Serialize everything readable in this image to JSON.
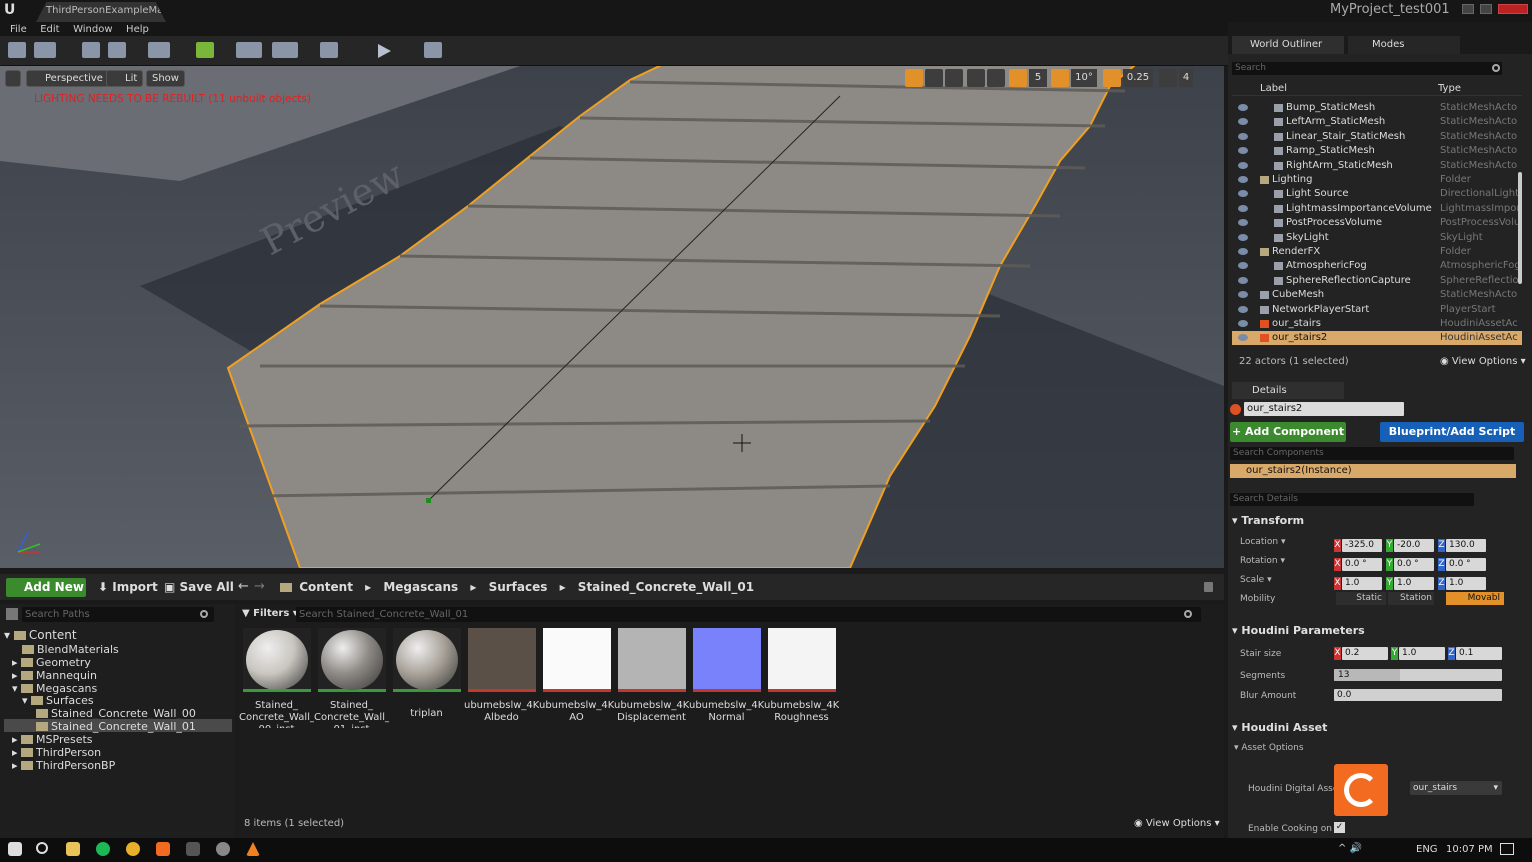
{
  "window": {
    "doc_tab": "ThirdPersonExampleMap*",
    "project": "MyProject_test001"
  },
  "menu": [
    "File",
    "Edit",
    "Window",
    "Help"
  ],
  "viewport": {
    "perspective": "Perspective",
    "lit": "Lit",
    "show": "Show",
    "warning": "LIGHTING NEEDS TO BE REBUILT (11 unbuilt objects)",
    "preview_watermark": "Preview",
    "grid_snap": "5",
    "rot_snap": "10°",
    "scale_snap": "0.25",
    "cam_speed": "4"
  },
  "outliner": {
    "tab_world": "World Outliner",
    "tab_modes": "Modes",
    "search_placeholder": "Search",
    "col_label": "Label",
    "col_type": "Type",
    "rows": [
      {
        "label": "Bump_StaticMesh",
        "type": "StaticMeshActor",
        "indent": 2
      },
      {
        "label": "LeftArm_StaticMesh",
        "type": "StaticMeshActor",
        "indent": 2
      },
      {
        "label": "Linear_Stair_StaticMesh",
        "type": "StaticMeshActor",
        "indent": 2
      },
      {
        "label": "Ramp_StaticMesh",
        "type": "StaticMeshActor",
        "indent": 2
      },
      {
        "label": "RightArm_StaticMesh",
        "type": "StaticMeshActor",
        "indent": 2
      },
      {
        "label": "Lighting",
        "type": "Folder",
        "indent": 1
      },
      {
        "label": "Light Source",
        "type": "DirectionalLight",
        "indent": 2
      },
      {
        "label": "LightmassImportanceVolume",
        "type": "LightmassImporta",
        "indent": 2
      },
      {
        "label": "PostProcessVolume",
        "type": "PostProcessVolu",
        "indent": 2
      },
      {
        "label": "SkyLight",
        "type": "SkyLight",
        "indent": 2
      },
      {
        "label": "RenderFX",
        "type": "Folder",
        "indent": 1
      },
      {
        "label": "AtmosphericFog",
        "type": "AtmosphericFog",
        "indent": 2
      },
      {
        "label": "SphereReflectionCapture",
        "type": "SphereReflection",
        "indent": 2
      },
      {
        "label": "CubeMesh",
        "type": "StaticMeshActor",
        "indent": 1
      },
      {
        "label": "NetworkPlayerStart",
        "type": "PlayerStart",
        "indent": 1
      },
      {
        "label": "our_stairs",
        "type": "HoudiniAssetActo",
        "indent": 1
      },
      {
        "label": "our_stairs2",
        "type": "HoudiniAssetActo",
        "indent": 1
      }
    ],
    "status": "22 actors (1 selected)",
    "view_options": "View Options"
  },
  "details": {
    "tab": "Details",
    "name": "our_stairs2",
    "add_component": "Add Component",
    "blueprint": "Blueprint/Add Script",
    "search_components": "Search Components",
    "instance": "our_stairs2(Instance)",
    "search_details": "Search Details",
    "transform": "Transform",
    "location_label": "Location",
    "rotation_label": "Rotation",
    "scale_label": "Scale",
    "mobility_label": "Mobility",
    "location": [
      "-325.0",
      "-20.0",
      "130.0"
    ],
    "rotation": [
      "0.0 °",
      "0.0 °",
      "0.0 °"
    ],
    "scale": [
      "1.0",
      "1.0",
      "1.0"
    ],
    "mobility": [
      "Static",
      "Station",
      "Movabl"
    ],
    "houdini_params": "Houdini Parameters",
    "stair_size_label": "Stair size",
    "stair_size": [
      "0.2",
      "1.0",
      "0.1"
    ],
    "segments_label": "Segments",
    "segments": "13",
    "segments_fill": 0.13,
    "blur_label": "Blur Amount",
    "blur": "0.0",
    "houdini_asset": "Houdini Asset",
    "asset_options": "Asset Options",
    "digital_asset_label": "Houdini Digital Asset",
    "digital_asset": "our_stairs",
    "cooking_label": "Enable Cooking on Pa"
  },
  "content": {
    "add_new": "Add New",
    "import": "Import",
    "save_all": "Save All",
    "breadcrumb": [
      "Content",
      "Megascans",
      "Surfaces",
      "Stained_Concrete_Wall_01"
    ],
    "search_paths": "Search Paths",
    "filters": "Filters",
    "search_assets": "Search Stained_Concrete_Wall_01",
    "tree": [
      {
        "label": "Content",
        "indent": 0
      },
      {
        "label": "BlendMaterials",
        "indent": 1
      },
      {
        "label": "Geometry",
        "indent": 1
      },
      {
        "label": "Mannequin",
        "indent": 1
      },
      {
        "label": "Megascans",
        "indent": 1
      },
      {
        "label": "Surfaces",
        "indent": 2
      },
      {
        "label": "Stained_Concrete_Wall_00",
        "indent": 3
      },
      {
        "label": "Stained_Concrete_Wall_01",
        "indent": 3
      },
      {
        "label": "MSPresets",
        "indent": 1
      },
      {
        "label": "ThirdPerson",
        "indent": 1
      },
      {
        "label": "ThirdPersonBP",
        "indent": 1
      }
    ],
    "assets": [
      {
        "l1": "Stained_",
        "l2": "Concrete_Wall_",
        "l3": "00_inst",
        "color": "#c9c6c0"
      },
      {
        "l1": "Stained_",
        "l2": "Concrete_Wall_",
        "l3": "01_inst",
        "color": "#8e8b86"
      },
      {
        "l1": "triplan",
        "l2": "",
        "l3": "",
        "color": "#a9a39a"
      },
      {
        "l1": "ubumebslw_4K_",
        "l2": "Albedo",
        "l3": "",
        "color": "#5b5048"
      },
      {
        "l1": "ubumebslw_4K_",
        "l2": "AO",
        "l3": "",
        "color": "#fafafa"
      },
      {
        "l1": "ubumebslw_4K_",
        "l2": "Displacement",
        "l3": "",
        "color": "#b4b4b4"
      },
      {
        "l1": "ubumebslw_4K_",
        "l2": "Normal",
        "l3": "",
        "color": "#7a82fb"
      },
      {
        "l1": "ubumebslw_4K_",
        "l2": "Roughness",
        "l3": "",
        "color": "#f4f4f4"
      }
    ],
    "status": "8 items (1 selected)",
    "view_options": "View Options"
  },
  "taskbar": {
    "lang": "ENG",
    "time": "10:07 PM"
  },
  "colors": {
    "accent_orange": "#f0a020",
    "selection_bg": "#d9a96a"
  }
}
